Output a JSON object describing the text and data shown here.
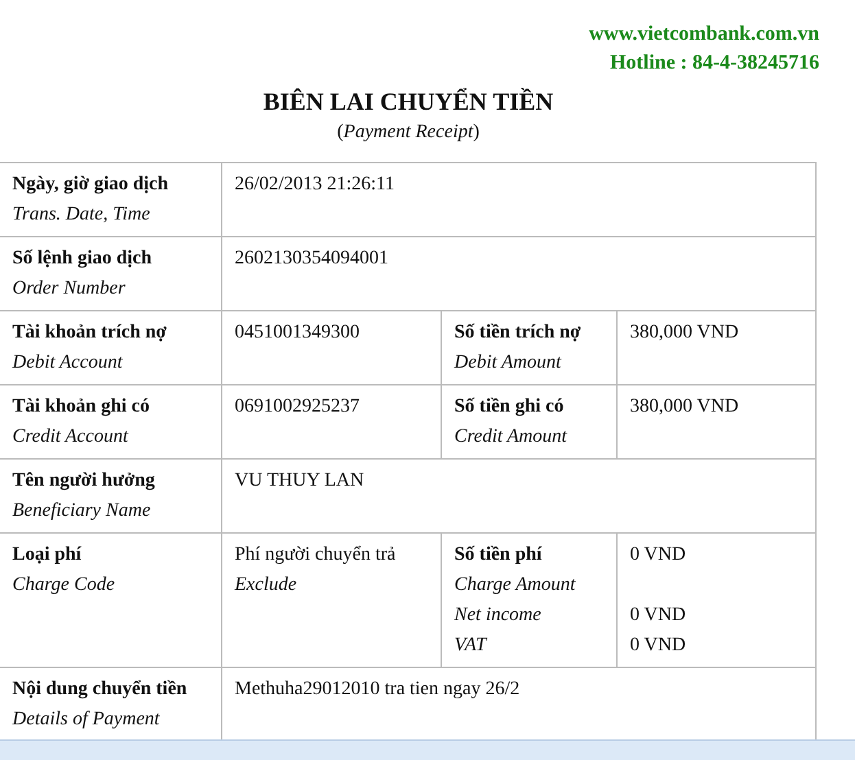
{
  "header": {
    "website": "www.vietcombank.com.vn",
    "hotline": "Hotline : 84-4-38245716"
  },
  "title": "BIÊN LAI CHUYỂN TIỀN",
  "subtitle": "(*Payment Receipt*)",
  "rows": [
    {
      "kind": "single",
      "label": "Ngày, giờ giao dịch",
      "label_en": "Trans. Date, Time",
      "value": "26/02/2013 21:26:11"
    },
    {
      "kind": "single",
      "label": "Số lệnh giao dịch",
      "label_en": "Order Number",
      "value": "2602130354094001"
    },
    {
      "kind": "pair",
      "label": "Tài khoản trích nợ",
      "label_en": "Debit Account",
      "value": "0451001349300",
      "label2": "Số tiền trích nợ",
      "label2_en": "Debit Amount",
      "value2": "380,000 VND"
    },
    {
      "kind": "pair",
      "label": "Tài khoản ghi có",
      "label_en": "Credit Account",
      "value": "0691002925237",
      "label2": "Số tiền ghi có",
      "label2_en": "Credit Amount",
      "value2": "380,000 VND"
    },
    {
      "kind": "single",
      "label": "Tên người hưởng",
      "label_en": "Beneficiary Name",
      "value": "VU THUY LAN"
    },
    {
      "kind": "fee",
      "label": "Loại phí",
      "label_en": "Charge Code",
      "value": "Phí người chuyển trả",
      "value_en": "Exclude",
      "label2": "Số tiền phí",
      "label2_en": "Charge Amount",
      "value2": "0 VND",
      "extras": [
        {
          "label": "Net income",
          "value": "0 VND"
        },
        {
          "label": "VAT",
          "value": "0 VND"
        }
      ]
    },
    {
      "kind": "single",
      "label": "Nội dung chuyển tiền",
      "label_en": "Details of Payment",
      "value": "Methuha29012010 tra tien ngay 26/2"
    }
  ]
}
